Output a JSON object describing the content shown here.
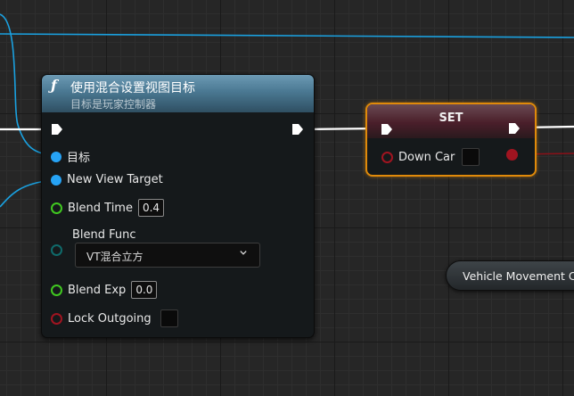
{
  "function_node": {
    "icon": "function-icon",
    "title": "使用混合设置视图目标",
    "subtitle": "目标是玩家控制器",
    "header_color": "#4a7892",
    "pins": {
      "target_label": "目标",
      "new_view_target_label": "New View Target",
      "blend_time_label": "Blend Time",
      "blend_time_value": "0.4",
      "blend_func_label": "Blend Func",
      "blend_func_value": "VT混合立方",
      "blend_exp_label": "Blend Exp",
      "blend_exp_value": "0.0",
      "lock_outgoing_label": "Lock Outgoing"
    }
  },
  "set_node": {
    "title": "SET",
    "variable_label": "Down Car",
    "border_color": "#e08a0a"
  },
  "vehicle_movement_node": {
    "label": "Vehicle Movement Co"
  },
  "colors": {
    "exec_wire": "#ffffff",
    "object_wire": "#1aa1e0",
    "float_pin": "#40c820",
    "bool_pin": "#a01420",
    "byte_pin": "#0f6a6a"
  }
}
